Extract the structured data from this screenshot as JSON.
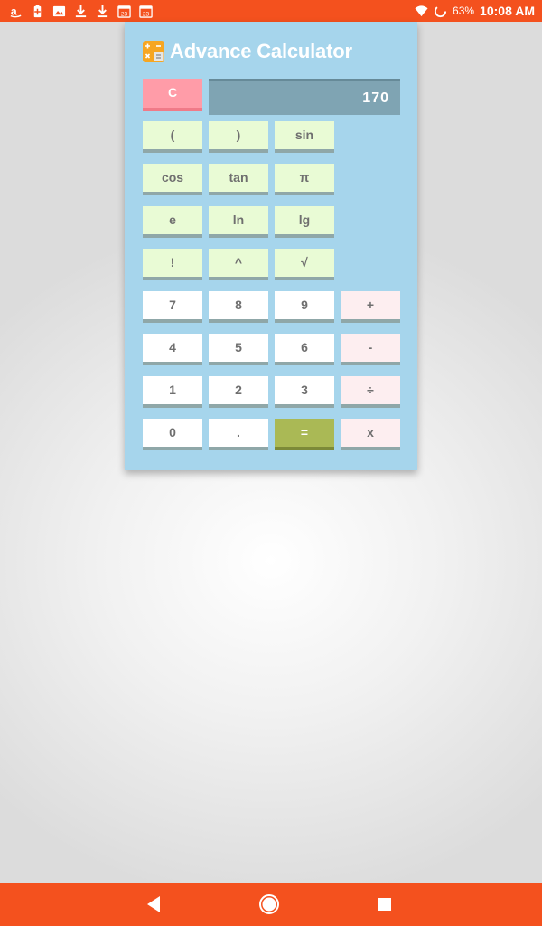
{
  "status_bar": {
    "battery_percent": "63%",
    "time": "10:08 AM",
    "notification_icons": [
      "amazon-icon",
      "battery-saver-icon",
      "image-icon",
      "download-icon",
      "download-icon",
      "calendar-icon",
      "calendar-icon"
    ],
    "calendar_day_1": "23",
    "calendar_day_2": "23"
  },
  "app": {
    "title": "Advance Calculator"
  },
  "display": {
    "value": "170"
  },
  "keys": {
    "clear": "C",
    "open_paren": "(",
    "close_paren": ")",
    "sin": "sin",
    "cos": "cos",
    "tan": "tan",
    "pi": "π",
    "e": "e",
    "ln": "ln",
    "lg": "lg",
    "factorial": "!",
    "power": "^",
    "sqrt": "√",
    "seven": "7",
    "eight": "8",
    "nine": "9",
    "plus": "+",
    "four": "4",
    "five": "5",
    "six": "6",
    "minus": "-",
    "one": "1",
    "two": "2",
    "three": "3",
    "divide": "÷",
    "zero": "0",
    "dot": ".",
    "equals": "=",
    "multiply": "x"
  },
  "colors": {
    "status_bar": "#f4511e",
    "card": "#a6d5ec",
    "display": "#7fa4b3",
    "scientific_key": "#e9fbd5",
    "operator_key": "#fdeef0",
    "equals_key": "#aab955",
    "clear_key": "#ff9ca8"
  },
  "nav_bar": {
    "icons": [
      "back-icon",
      "home-icon",
      "recents-icon"
    ]
  }
}
